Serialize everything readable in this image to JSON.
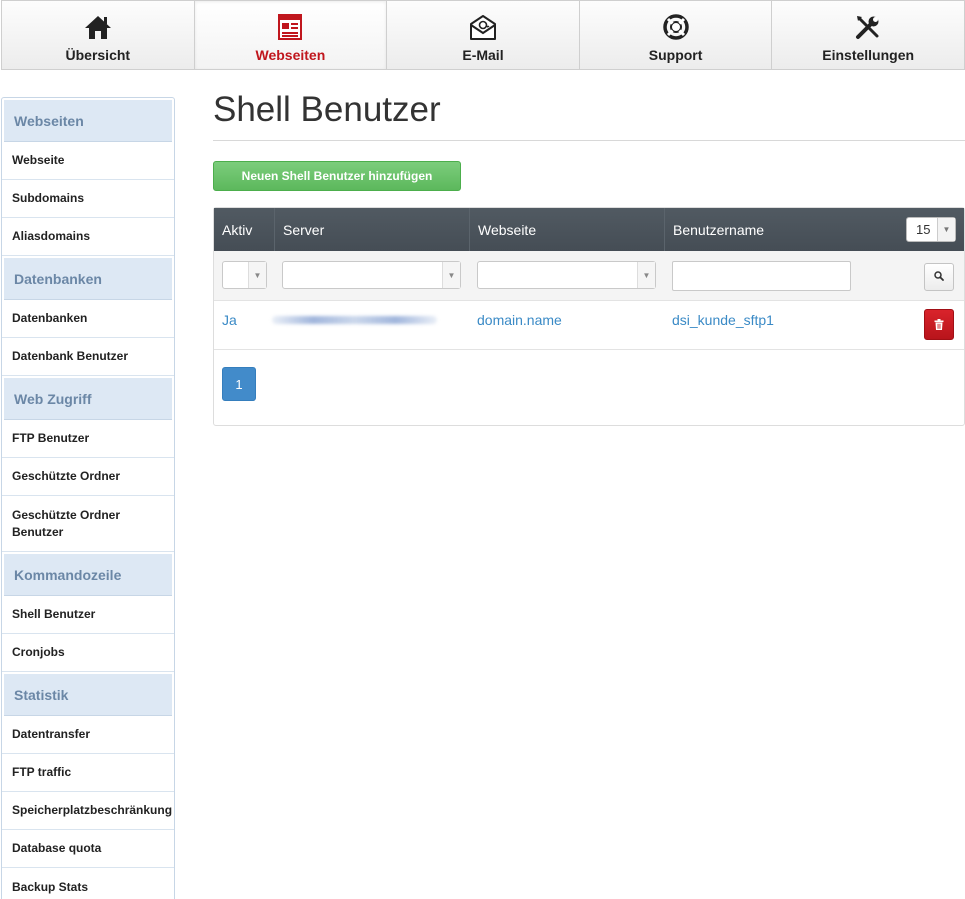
{
  "nav": {
    "tabs": [
      {
        "label": "Übersicht",
        "icon": "home-icon"
      },
      {
        "label": "Webseiten",
        "icon": "webpage-icon",
        "active": true
      },
      {
        "label": "E-Mail",
        "icon": "email-icon"
      },
      {
        "label": "Support",
        "icon": "lifebuoy-icon"
      },
      {
        "label": "Einstellungen",
        "icon": "tools-icon"
      }
    ]
  },
  "sidebar": {
    "sections": [
      {
        "title": "Webseiten",
        "items": [
          "Webseite",
          "Subdomains",
          "Aliasdomains"
        ]
      },
      {
        "title": "Datenbanken",
        "items": [
          "Datenbanken",
          "Datenbank Benutzer"
        ]
      },
      {
        "title": "Web Zugriff",
        "items": [
          "FTP Benutzer",
          "Geschützte Ordner",
          "Geschützte Ordner Benutzer"
        ]
      },
      {
        "title": "Kommandozeile",
        "items": [
          "Shell Benutzer",
          "Cronjobs"
        ]
      },
      {
        "title": "Statistik",
        "items": [
          "Datentransfer",
          "FTP traffic",
          "Speicherplatzbeschränkung",
          "Database quota",
          "Backup Stats"
        ]
      }
    ]
  },
  "main": {
    "title": "Shell Benutzer",
    "add_button": "Neuen Shell Benutzer hinzufügen",
    "table": {
      "columns": [
        "Aktiv",
        "Server",
        "Webseite",
        "Benutzername"
      ],
      "page_size": "15",
      "rows": [
        {
          "aktiv": "Ja",
          "webseite": "domain.name",
          "benutzername": "dsi_kunde_sftp1"
        }
      ]
    },
    "pagination": {
      "current": "1"
    }
  },
  "colors": {
    "accent": "#c0161d",
    "primary": "#428bca",
    "success": "#5cb85c",
    "danger": "#c9171e",
    "header": "#4b535b"
  }
}
